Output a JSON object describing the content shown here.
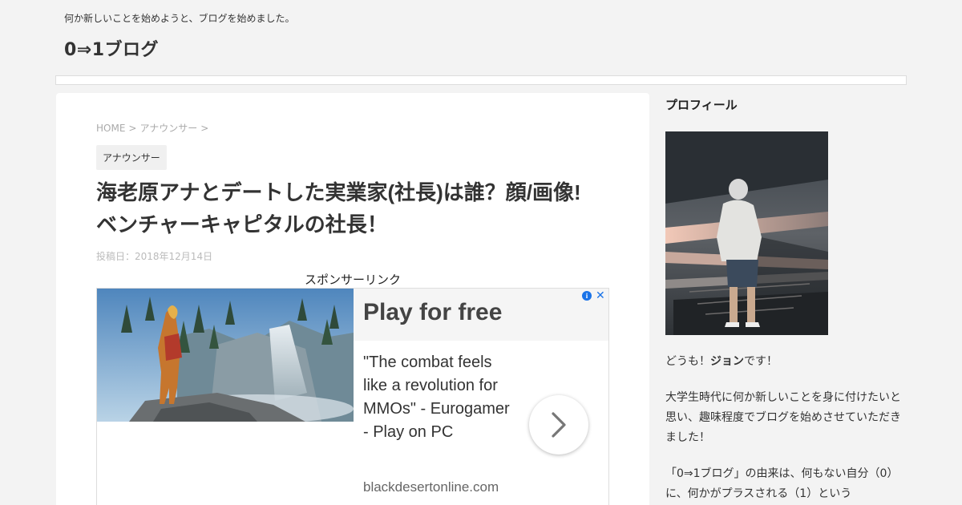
{
  "header": {
    "tagline": "何か新しいことを始めようと、ブログを始めました。",
    "site_title": "0⇒1ブログ"
  },
  "breadcrumb": {
    "home": "HOME",
    "separator": ">",
    "category": "アナウンサー"
  },
  "post": {
    "category_badge": "アナウンサー",
    "title_line1": "海老原アナとデートした実業家(社長)は誰？顔/画像!",
    "title_line2": "ベンチャーキャピタルの社長！",
    "date": "投稿日：2018年12月14日"
  },
  "ad": {
    "sponsor_label": "スポンサーリンク",
    "headline": "Play for free",
    "body": "\"The combat feels like a revolution for MMOs\" - Eurogamer - Play on PC",
    "domain": "blackdesertonline.com",
    "info_icon": "info-icon",
    "close_icon": "close-icon",
    "arrow_icon": "chevron-right-icon"
  },
  "sidebar": {
    "profile_title": "プロフィール",
    "greeting_prefix": "どうも！",
    "greeting_name": "ジョン",
    "greeting_suffix": "です！",
    "paragraph2": "大学生時代に何か新しいことを身に付けたいと思い、趣味程度でブログを始めさせていただきました！",
    "paragraph3": "「0⇒1ブログ」の由来は、何もない自分（0）に、何かがプラスされる（1）という"
  },
  "colors": {
    "background": "#f3f3f3",
    "card": "#ffffff",
    "ad_accent": "#1a73e8",
    "muted_text": "#aaaaaa"
  }
}
